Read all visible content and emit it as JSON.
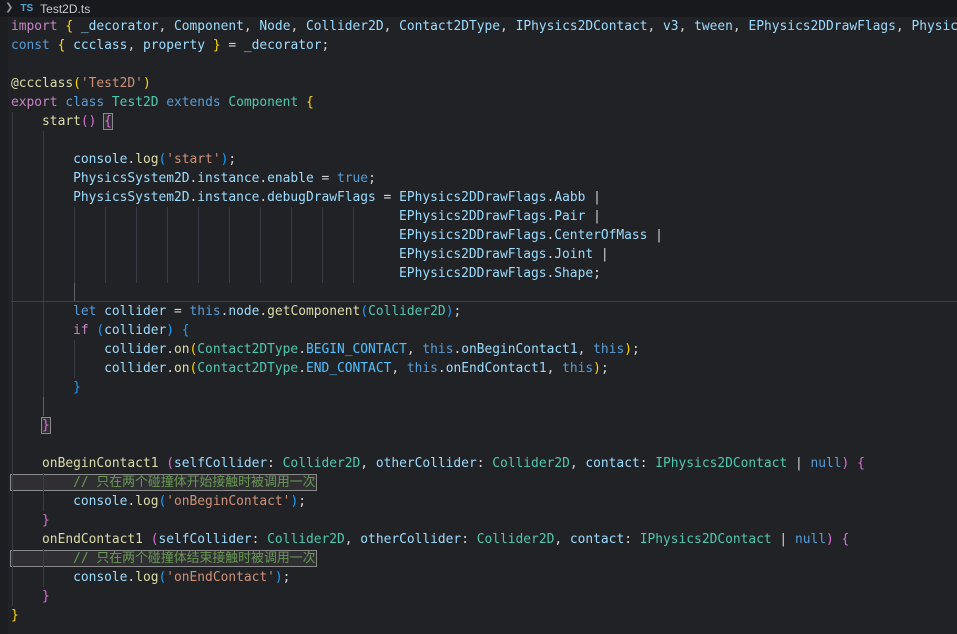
{
  "breadcrumb": {
    "chevron": "❯",
    "file_type": "TS",
    "filename": "Test2D.ts"
  },
  "colors": {
    "editor_bg": "#212226",
    "topbar_bg": "#17191d",
    "kw1": "#C586C0",
    "kw2": "#569CD6",
    "var": "#9CDCFE",
    "fn": "#DCDCAA",
    "type": "#4EC9B0",
    "str": "#CE9178",
    "com": "#6A9955",
    "fg": "#D4D4D4",
    "cnst": "#4FC1FF",
    "b1": "#FFD700",
    "b2": "#DA70D6",
    "b3": "#179FFF",
    "b1m": "#FFD700",
    "b2m": "#DA70D6",
    "b3m": "#179FFF",
    "guide": "#393d45",
    "guide_active": "#5a5f68",
    "divider": "#3e424a"
  },
  "code": {
    "lines": [
      {
        "indent": 0,
        "tokens": [
          [
            "kw1",
            "import"
          ],
          [
            "fg",
            " "
          ],
          [
            "b1",
            "{"
          ],
          [
            "fg",
            " "
          ],
          [
            "var",
            "_decorator"
          ],
          [
            "fg",
            ", "
          ],
          [
            "var",
            "Component"
          ],
          [
            "fg",
            ", "
          ],
          [
            "var",
            "Node"
          ],
          [
            "fg",
            ", "
          ],
          [
            "var",
            "Collider2D"
          ],
          [
            "fg",
            ", "
          ],
          [
            "var",
            "Contact2DType"
          ],
          [
            "fg",
            ", "
          ],
          [
            "var",
            "IPhysics2DContact"
          ],
          [
            "fg",
            ", "
          ],
          [
            "var",
            "v3"
          ],
          [
            "fg",
            ", "
          ],
          [
            "var",
            "tween"
          ],
          [
            "fg",
            ", "
          ],
          [
            "var",
            "EPhysics2DDrawFlags"
          ],
          [
            "fg",
            ", "
          ],
          [
            "var",
            "Physics"
          ]
        ]
      },
      {
        "indent": 0,
        "tokens": [
          [
            "kw2",
            "const"
          ],
          [
            "fg",
            " "
          ],
          [
            "b1",
            "{"
          ],
          [
            "fg",
            " "
          ],
          [
            "var",
            "ccclass"
          ],
          [
            "fg",
            ", "
          ],
          [
            "var",
            "property"
          ],
          [
            "fg",
            " "
          ],
          [
            "b1",
            "}"
          ],
          [
            "fg",
            " = "
          ],
          [
            "var",
            "_decorator"
          ],
          [
            "fg",
            ";"
          ]
        ]
      },
      {
        "indent": 0,
        "tokens": []
      },
      {
        "indent": 0,
        "tokens": [
          [
            "fn",
            "@ccclass"
          ],
          [
            "b1",
            "("
          ],
          [
            "str",
            "'Test2D'"
          ],
          [
            "b1",
            ")"
          ]
        ]
      },
      {
        "indent": 0,
        "tokens": [
          [
            "kw1",
            "export"
          ],
          [
            "fg",
            " "
          ],
          [
            "kw2",
            "class"
          ],
          [
            "fg",
            " "
          ],
          [
            "type",
            "Test2D"
          ],
          [
            "fg",
            " "
          ],
          [
            "kw2",
            "extends"
          ],
          [
            "fg",
            " "
          ],
          [
            "type",
            "Component"
          ],
          [
            "fg",
            " "
          ],
          [
            "b1",
            "{"
          ]
        ]
      },
      {
        "indent": 1,
        "tokens": [
          [
            "fg",
            "    "
          ],
          [
            "fn",
            "start"
          ],
          [
            "b2",
            "()"
          ],
          [
            "fg",
            " "
          ],
          [
            "b2m",
            "{"
          ]
        ]
      },
      {
        "indent": 2,
        "tokens": []
      },
      {
        "indent": 2,
        "tokens": [
          [
            "fg",
            "        "
          ],
          [
            "var",
            "console"
          ],
          [
            "fg",
            "."
          ],
          [
            "fn",
            "log"
          ],
          [
            "b3",
            "("
          ],
          [
            "str",
            "'start'"
          ],
          [
            "b3",
            ")"
          ],
          [
            "fg",
            ";"
          ]
        ]
      },
      {
        "indent": 2,
        "tokens": [
          [
            "fg",
            "        "
          ],
          [
            "var",
            "PhysicsSystem2D"
          ],
          [
            "fg",
            "."
          ],
          [
            "var",
            "instance"
          ],
          [
            "fg",
            "."
          ],
          [
            "var",
            "enable"
          ],
          [
            "fg",
            " = "
          ],
          [
            "kw2",
            "true"
          ],
          [
            "fg",
            ";"
          ]
        ]
      },
      {
        "indent": 2,
        "tokens": [
          [
            "fg",
            "        "
          ],
          [
            "var",
            "PhysicsSystem2D"
          ],
          [
            "fg",
            "."
          ],
          [
            "var",
            "instance"
          ],
          [
            "fg",
            "."
          ],
          [
            "var",
            "debugDrawFlags"
          ],
          [
            "fg",
            " = "
          ],
          [
            "var",
            "EPhysics2DDrawFlags"
          ],
          [
            "fg",
            "."
          ],
          [
            "var",
            "Aabb"
          ],
          [
            "fg",
            " |"
          ]
        ]
      },
      {
        "indent": 12,
        "tokens": [
          [
            "fg",
            "                                                  "
          ],
          [
            "var",
            "EPhysics2DDrawFlags"
          ],
          [
            "fg",
            "."
          ],
          [
            "var",
            "Pair"
          ],
          [
            "fg",
            " |"
          ]
        ]
      },
      {
        "indent": 12,
        "tokens": [
          [
            "fg",
            "                                                  "
          ],
          [
            "var",
            "EPhysics2DDrawFlags"
          ],
          [
            "fg",
            "."
          ],
          [
            "var",
            "CenterOfMass"
          ],
          [
            "fg",
            " |"
          ]
        ]
      },
      {
        "indent": 12,
        "tokens": [
          [
            "fg",
            "                                                  "
          ],
          [
            "var",
            "EPhysics2DDrawFlags"
          ],
          [
            "fg",
            "."
          ],
          [
            "var",
            "Joint"
          ],
          [
            "fg",
            " |"
          ]
        ]
      },
      {
        "indent": 12,
        "tokens": [
          [
            "fg",
            "                                                  "
          ],
          [
            "var",
            "EPhysics2DDrawFlags"
          ],
          [
            "fg",
            "."
          ],
          [
            "var",
            "Shape"
          ],
          [
            "fg",
            ";"
          ]
        ]
      },
      {
        "indent": 3,
        "active_guide": 2,
        "divider": true,
        "tokens": []
      },
      {
        "indent": 2,
        "tokens": [
          [
            "fg",
            "        "
          ],
          [
            "kw2",
            "let"
          ],
          [
            "fg",
            " "
          ],
          [
            "var",
            "collider"
          ],
          [
            "fg",
            " = "
          ],
          [
            "kw2",
            "this"
          ],
          [
            "fg",
            "."
          ],
          [
            "var",
            "node"
          ],
          [
            "fg",
            "."
          ],
          [
            "fn",
            "getComponent"
          ],
          [
            "b3",
            "("
          ],
          [
            "type",
            "Collider2D"
          ],
          [
            "b3",
            ")"
          ],
          [
            "fg",
            ";"
          ]
        ]
      },
      {
        "indent": 2,
        "tokens": [
          [
            "fg",
            "        "
          ],
          [
            "kw1",
            "if"
          ],
          [
            "fg",
            " "
          ],
          [
            "b3",
            "("
          ],
          [
            "var",
            "collider"
          ],
          [
            "b3",
            ")"
          ],
          [
            "fg",
            " "
          ],
          [
            "b3",
            "{"
          ]
        ]
      },
      {
        "indent": 3,
        "tokens": [
          [
            "fg",
            "            "
          ],
          [
            "var",
            "collider"
          ],
          [
            "fg",
            "."
          ],
          [
            "fn",
            "on"
          ],
          [
            "b1",
            "("
          ],
          [
            "type",
            "Contact2DType"
          ],
          [
            "fg",
            "."
          ],
          [
            "cnst",
            "BEGIN_CONTACT"
          ],
          [
            "fg",
            ", "
          ],
          [
            "kw2",
            "this"
          ],
          [
            "fg",
            "."
          ],
          [
            "var",
            "onBeginContact1"
          ],
          [
            "fg",
            ", "
          ],
          [
            "kw2",
            "this"
          ],
          [
            "b1",
            ")"
          ],
          [
            "fg",
            ";"
          ]
        ]
      },
      {
        "indent": 3,
        "tokens": [
          [
            "fg",
            "            "
          ],
          [
            "var",
            "collider"
          ],
          [
            "fg",
            "."
          ],
          [
            "fn",
            "on"
          ],
          [
            "b1",
            "("
          ],
          [
            "type",
            "Contact2DType"
          ],
          [
            "fg",
            "."
          ],
          [
            "cnst",
            "END_CONTACT"
          ],
          [
            "fg",
            ", "
          ],
          [
            "kw2",
            "this"
          ],
          [
            "fg",
            "."
          ],
          [
            "var",
            "onEndContact1"
          ],
          [
            "fg",
            ", "
          ],
          [
            "kw2",
            "this"
          ],
          [
            "b1",
            ")"
          ],
          [
            "fg",
            ";"
          ]
        ]
      },
      {
        "indent": 2,
        "tokens": [
          [
            "fg",
            "        "
          ],
          [
            "b3",
            "}"
          ]
        ]
      },
      {
        "indent": 2,
        "active_guide": 1,
        "tokens": []
      },
      {
        "indent": 1,
        "tokens": [
          [
            "fg",
            "    "
          ],
          [
            "b2m",
            "}"
          ]
        ]
      },
      {
        "indent": 1,
        "tokens": []
      },
      {
        "indent": 1,
        "tokens": [
          [
            "fg",
            "    "
          ],
          [
            "fn",
            "onBeginContact1"
          ],
          [
            "fg",
            " "
          ],
          [
            "b2",
            "("
          ],
          [
            "var",
            "selfCollider"
          ],
          [
            "fg",
            ": "
          ],
          [
            "type",
            "Collider2D"
          ],
          [
            "fg",
            ", "
          ],
          [
            "var",
            "otherCollider"
          ],
          [
            "fg",
            ": "
          ],
          [
            "type",
            "Collider2D"
          ],
          [
            "fg",
            ", "
          ],
          [
            "var",
            "contact"
          ],
          [
            "fg",
            ": "
          ],
          [
            "type",
            "IPhysics2DContact"
          ],
          [
            "fg",
            " | "
          ],
          [
            "kw2",
            "null"
          ],
          [
            "b2",
            ")"
          ],
          [
            "fg",
            " "
          ],
          [
            "b2",
            "{"
          ]
        ]
      },
      {
        "indent": 2,
        "tokens": [
          [
            "com",
            "        // 只在两个碰撞体开始接触时被调用一次"
          ]
        ]
      },
      {
        "indent": 2,
        "tokens": [
          [
            "fg",
            "        "
          ],
          [
            "var",
            "console"
          ],
          [
            "fg",
            "."
          ],
          [
            "fn",
            "log"
          ],
          [
            "b3",
            "("
          ],
          [
            "str",
            "'onBeginContact'"
          ],
          [
            "b3",
            ")"
          ],
          [
            "fg",
            ";"
          ]
        ]
      },
      {
        "indent": 1,
        "tokens": [
          [
            "fg",
            "    "
          ],
          [
            "b2",
            "}"
          ]
        ]
      },
      {
        "indent": 1,
        "tokens": [
          [
            "fg",
            "    "
          ],
          [
            "fn",
            "onEndContact1"
          ],
          [
            "fg",
            " "
          ],
          [
            "b2",
            "("
          ],
          [
            "var",
            "selfCollider"
          ],
          [
            "fg",
            ": "
          ],
          [
            "type",
            "Collider2D"
          ],
          [
            "fg",
            ", "
          ],
          [
            "var",
            "otherCollider"
          ],
          [
            "fg",
            ": "
          ],
          [
            "type",
            "Collider2D"
          ],
          [
            "fg",
            ", "
          ],
          [
            "var",
            "contact"
          ],
          [
            "fg",
            ": "
          ],
          [
            "type",
            "IPhysics2DContact"
          ],
          [
            "fg",
            " | "
          ],
          [
            "kw2",
            "null"
          ],
          [
            "b2",
            ")"
          ],
          [
            "fg",
            " "
          ],
          [
            "b2",
            "{"
          ]
        ]
      },
      {
        "indent": 2,
        "tokens": [
          [
            "com",
            "        // 只在两个碰撞体结束接触时被调用一次"
          ]
        ]
      },
      {
        "indent": 2,
        "tokens": [
          [
            "fg",
            "        "
          ],
          [
            "var",
            "console"
          ],
          [
            "fg",
            "."
          ],
          [
            "fn",
            "log"
          ],
          [
            "b3",
            "("
          ],
          [
            "str",
            "'onEndContact'"
          ],
          [
            "b3",
            ")"
          ],
          [
            "fg",
            ";"
          ]
        ]
      },
      {
        "indent": 1,
        "tokens": [
          [
            "fg",
            "    "
          ],
          [
            "b2",
            "}"
          ]
        ]
      },
      {
        "indent": 0,
        "tokens": [
          [
            "b1",
            "}"
          ]
        ]
      }
    ]
  }
}
